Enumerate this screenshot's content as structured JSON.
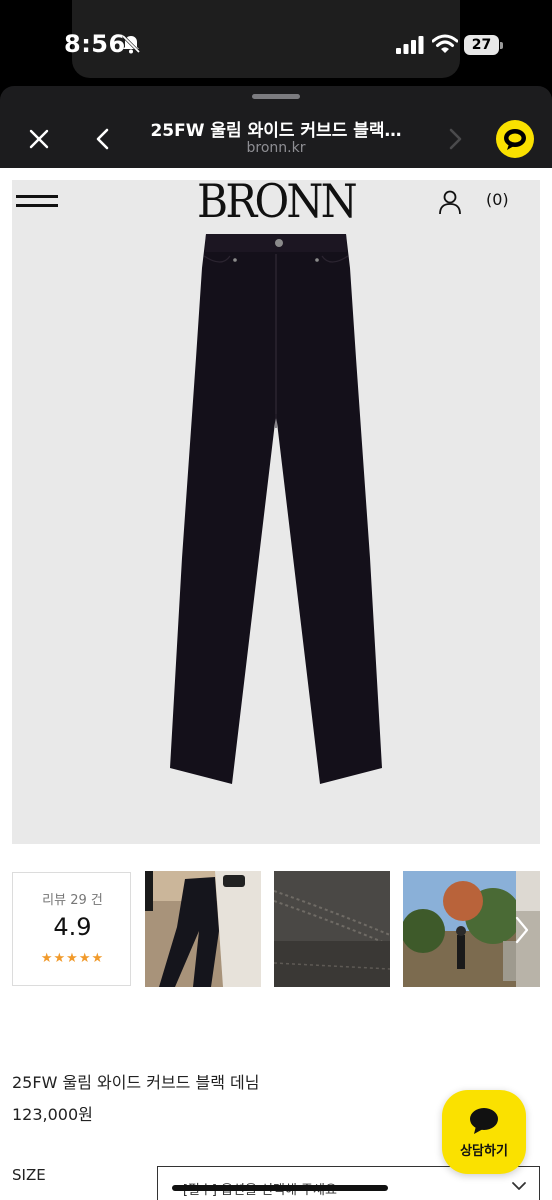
{
  "status_bar": {
    "time": "8:56",
    "battery": "27"
  },
  "browser": {
    "title": "25FW 울림 와이드 커브드 블랙…",
    "url": "bronn.kr"
  },
  "site": {
    "logo": "BRONN",
    "cart_count": "(0)"
  },
  "reviews": {
    "label": "리뷰 29 건",
    "score": "4.9",
    "stars": "★★★★★"
  },
  "product": {
    "name": "25FW 울림 와이드 커브드 블랙 데님",
    "price": "123,000원"
  },
  "options": {
    "size_label": "SIZE",
    "size_value": "- [필수] 옵션을 선택해 주세요 -"
  },
  "chat": {
    "label": "상담하기"
  },
  "colors": {
    "kakao_yellow": "#fae100",
    "star_orange": "#f19a2b"
  }
}
